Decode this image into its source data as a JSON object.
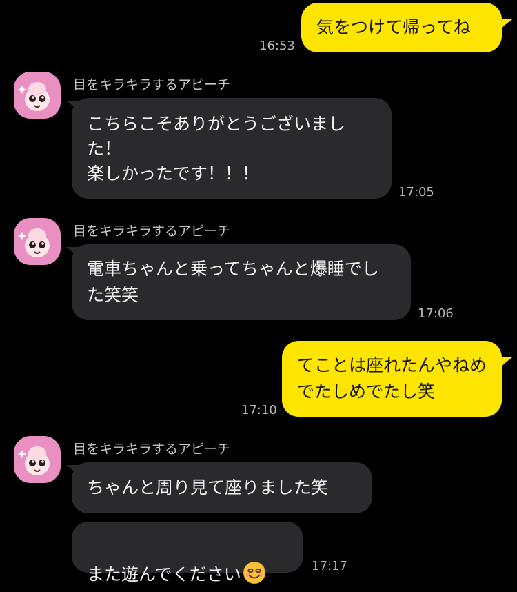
{
  "chat": {
    "messages": [
      {
        "kind": "sent",
        "text": "気をつけて帰ってね",
        "time": "16:53"
      },
      {
        "kind": "received",
        "sender": "目をキラキラするアピーチ",
        "text": "こちらこそありがとうございました！\n楽しかったです！！！",
        "time": "17:05"
      },
      {
        "kind": "received",
        "sender": "目をキラキラするアピーチ",
        "text": "電車ちゃんと乗ってちゃんと爆睡でした笑笑",
        "time": "17:06"
      },
      {
        "kind": "sent",
        "text": "てことは座れたんやねめでたしめでたし笑",
        "time": "17:10"
      },
      {
        "kind": "received",
        "sender": "目をキラキラするアピーチ",
        "text": "ちゃんと周り見て座りました笑"
      },
      {
        "kind": "received",
        "text": "また遊んでください",
        "time": "17:17",
        "emoji": "smiling-face-icon"
      }
    ]
  },
  "colors": {
    "background": "#000000",
    "sent_bubble": "#fde500",
    "received_bubble": "#2a2a2c",
    "avatar_bg": "#e98fc2"
  }
}
